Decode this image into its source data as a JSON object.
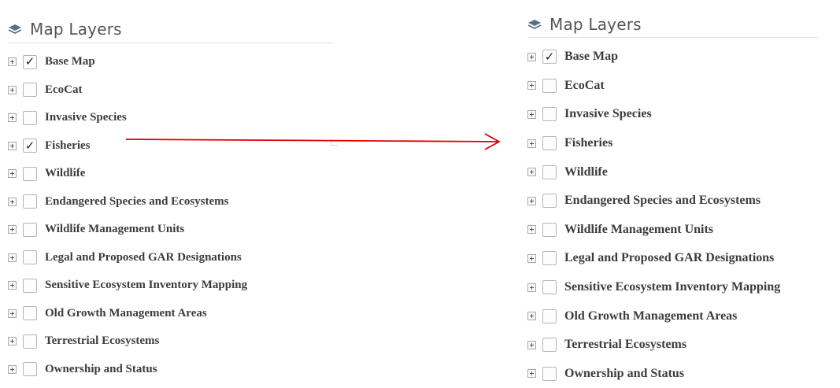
{
  "colors": {
    "arrow": "#e00000",
    "icon": "#5a6f86"
  },
  "left_panel": {
    "title": "Map Layers",
    "icon": "layers-icon",
    "layers": [
      {
        "label": "Base Map",
        "checked": true
      },
      {
        "label": "EcoCat",
        "checked": false
      },
      {
        "label": "Invasive Species",
        "checked": false
      },
      {
        "label": "Fisheries",
        "checked": true
      },
      {
        "label": "Wildlife",
        "checked": false
      },
      {
        "label": "Endangered Species and Ecosystems",
        "checked": false
      },
      {
        "label": "Wildlife Management Units",
        "checked": false
      },
      {
        "label": "Legal and Proposed GAR Designations",
        "checked": false
      },
      {
        "label": "Sensitive Ecosystem Inventory Mapping",
        "checked": false
      },
      {
        "label": "Old Growth Management Areas",
        "checked": false
      },
      {
        "label": "Terrestrial Ecosystems",
        "checked": false
      },
      {
        "label": "Ownership and Status",
        "checked": false
      }
    ]
  },
  "right_panel": {
    "title": "Map Layers",
    "icon": "layers-icon",
    "layers": [
      {
        "label": "Base Map",
        "checked": true
      },
      {
        "label": "EcoCat",
        "checked": false
      },
      {
        "label": "Invasive Species",
        "checked": false
      },
      {
        "label": "Fisheries",
        "checked": false
      },
      {
        "label": "Wildlife",
        "checked": false
      },
      {
        "label": "Endangered Species and Ecosystems",
        "checked": false
      },
      {
        "label": "Wildlife Management Units",
        "checked": false
      },
      {
        "label": "Legal and Proposed GAR Designations",
        "checked": false
      },
      {
        "label": "Sensitive Ecosystem Inventory Mapping",
        "checked": false
      },
      {
        "label": "Old Growth Management Areas",
        "checked": false
      },
      {
        "label": "Terrestrial Ecosystems",
        "checked": false
      },
      {
        "label": "Ownership and Status",
        "checked": false
      }
    ]
  }
}
